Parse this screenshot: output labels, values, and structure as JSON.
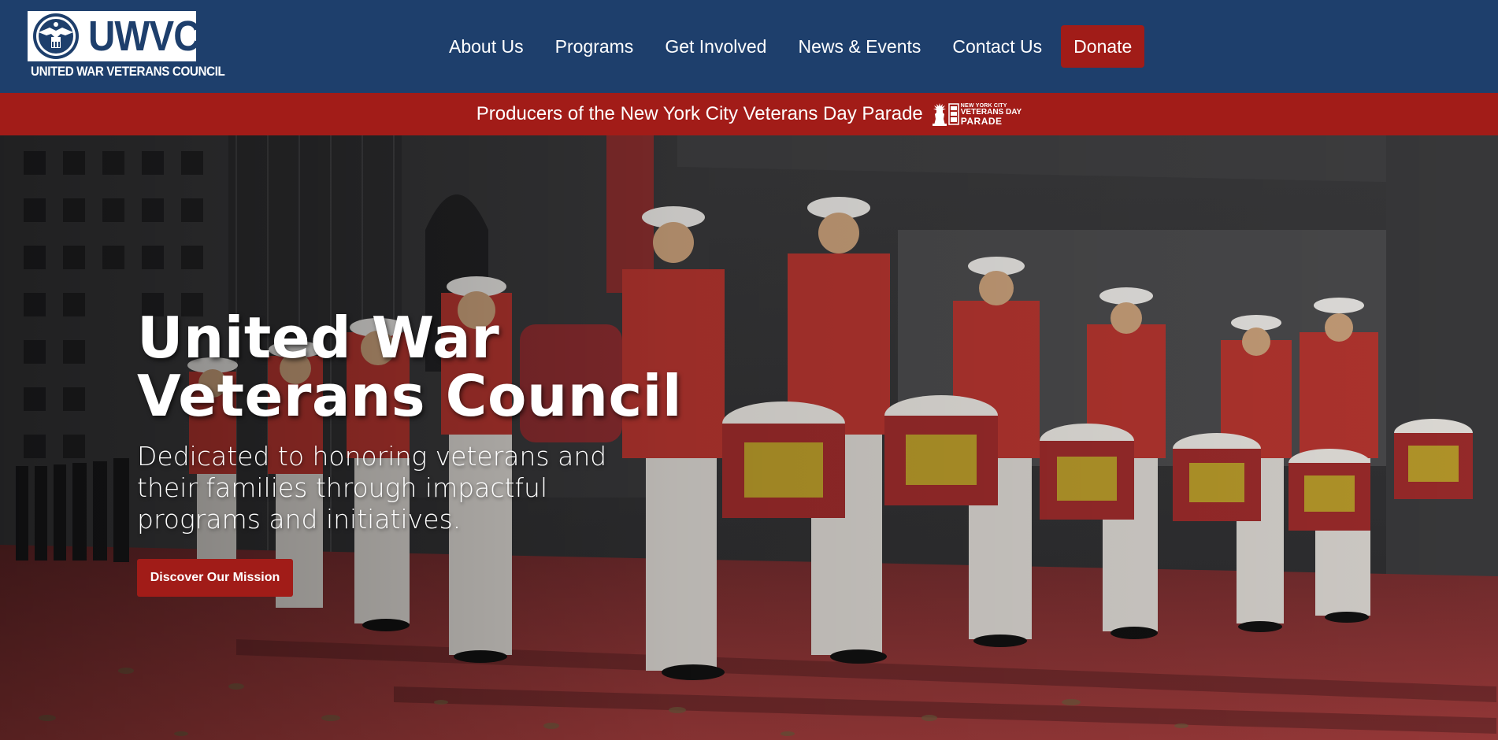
{
  "header": {
    "logo": {
      "abbr": "UWVC",
      "name": "UNITED WAR VETERANS COUNCIL"
    },
    "nav": [
      {
        "label": "About Us"
      },
      {
        "label": "Programs"
      },
      {
        "label": "Get Involved"
      },
      {
        "label": "News & Events"
      },
      {
        "label": "Contact Us"
      }
    ],
    "donate_label": "Donate"
  },
  "banner": {
    "text": "Producers of the New York City Veterans Day Parade",
    "parade_logo": {
      "line1": "NEW YORK CITY",
      "line2": "VETERANS DAY",
      "line3": "PARADE",
      "icon": "statue-of-liberty-icon"
    }
  },
  "hero": {
    "title_line1": "United War",
    "title_line2": "Veterans Council",
    "subtitle": "Dedicated to honoring veterans and their families through impactful programs and initiatives.",
    "cta_label": "Discover Our Mission",
    "image": "marine-drum-corps-parade-photo"
  },
  "colors": {
    "header_blue": "#1e3f6c",
    "banner_red": "#a21c18",
    "button_red": "#a11c18",
    "carpet_red": "#8d2b2b"
  }
}
